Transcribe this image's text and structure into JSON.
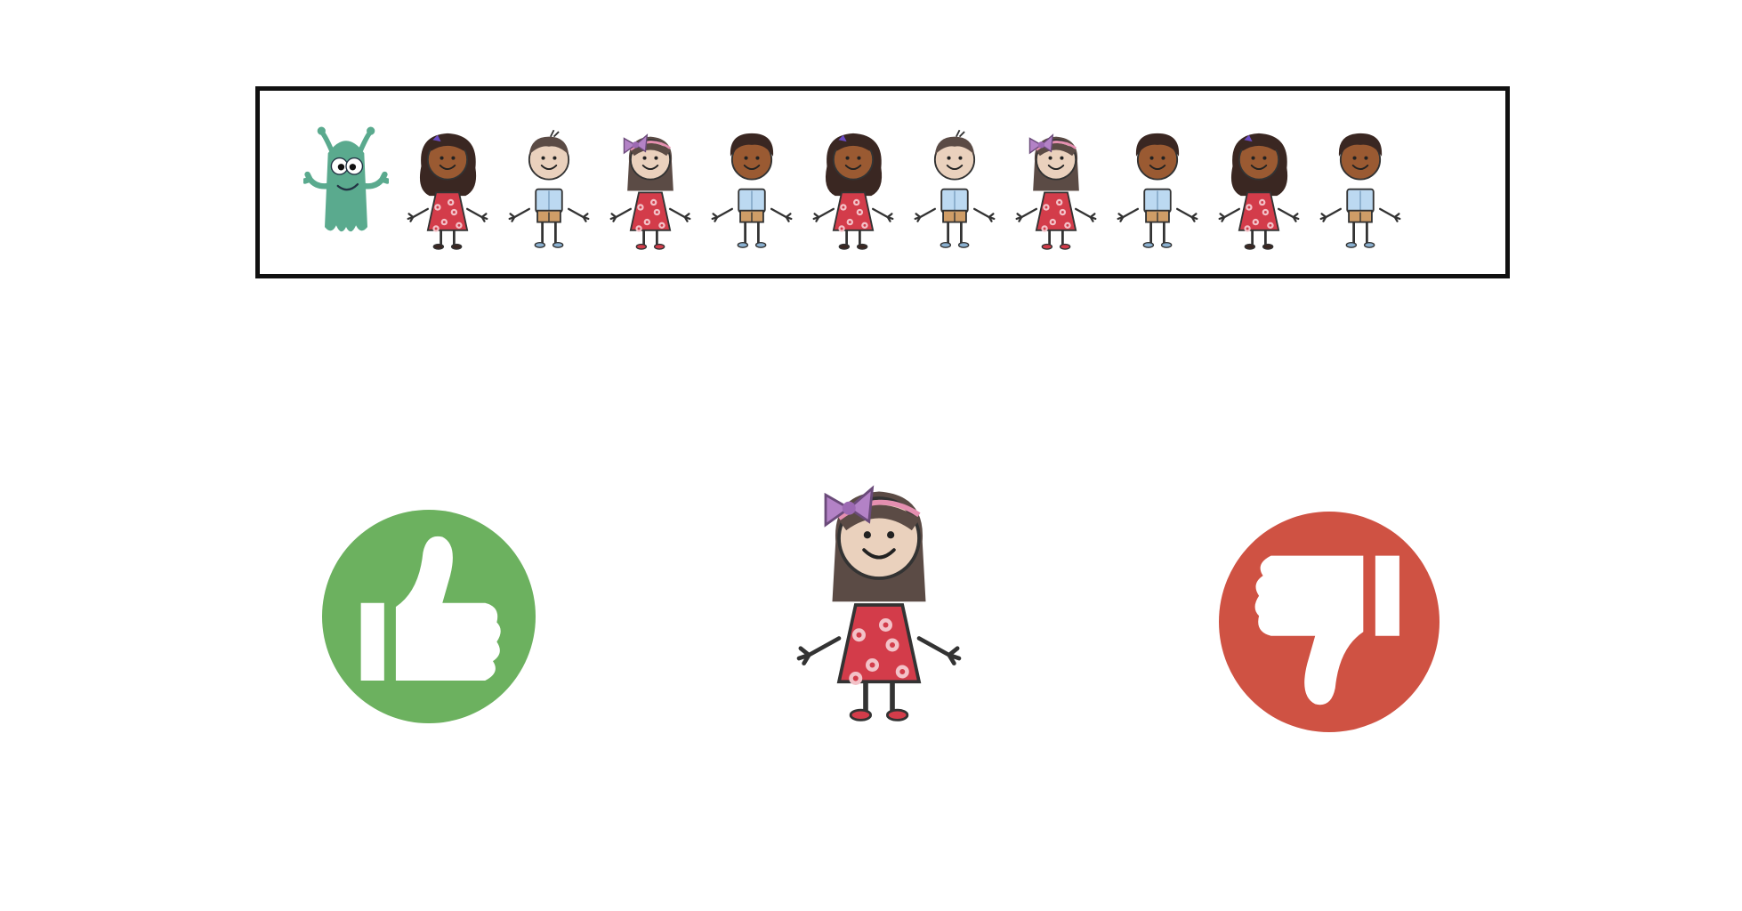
{
  "sequence": {
    "items": [
      {
        "kind": "monster",
        "icon": "green-monster-icon"
      },
      {
        "kind": "girl-curly",
        "icon": "girl-curly-hair-icon"
      },
      {
        "kind": "boy-light",
        "icon": "boy-light-skin-icon"
      },
      {
        "kind": "girl-bow",
        "icon": "girl-pink-bow-icon"
      },
      {
        "kind": "boy-dark",
        "icon": "boy-dark-skin-icon"
      },
      {
        "kind": "girl-curly",
        "icon": "girl-curly-hair-icon"
      },
      {
        "kind": "boy-light",
        "icon": "boy-light-skin-icon"
      },
      {
        "kind": "girl-bow",
        "icon": "girl-pink-bow-icon"
      },
      {
        "kind": "boy-dark",
        "icon": "boy-dark-skin-icon"
      },
      {
        "kind": "girl-curly",
        "icon": "girl-curly-hair-icon"
      },
      {
        "kind": "boy-dark",
        "icon": "boy-dark-skin-icon"
      }
    ]
  },
  "target": {
    "kind": "girl-bow",
    "icon": "girl-pink-bow-icon"
  },
  "choices": {
    "approve": {
      "icon": "thumbs-up-icon",
      "color": "#6cb15f"
    },
    "reject": {
      "icon": "thumbs-down-icon",
      "color": "#cf5243"
    }
  },
  "colors": {
    "monster": "#5aaa8e",
    "dress": "#d33c4a",
    "shirt": "#bcd9f1",
    "shorts": "#cf9d67",
    "skin_light": "#ead1bd",
    "skin_dark": "#9a5a32",
    "hair_brown": "#5b4b45",
    "hair_dark": "#3a2722",
    "bow_pink": "#b382c6",
    "bow_purple": "#6a4bc4"
  }
}
